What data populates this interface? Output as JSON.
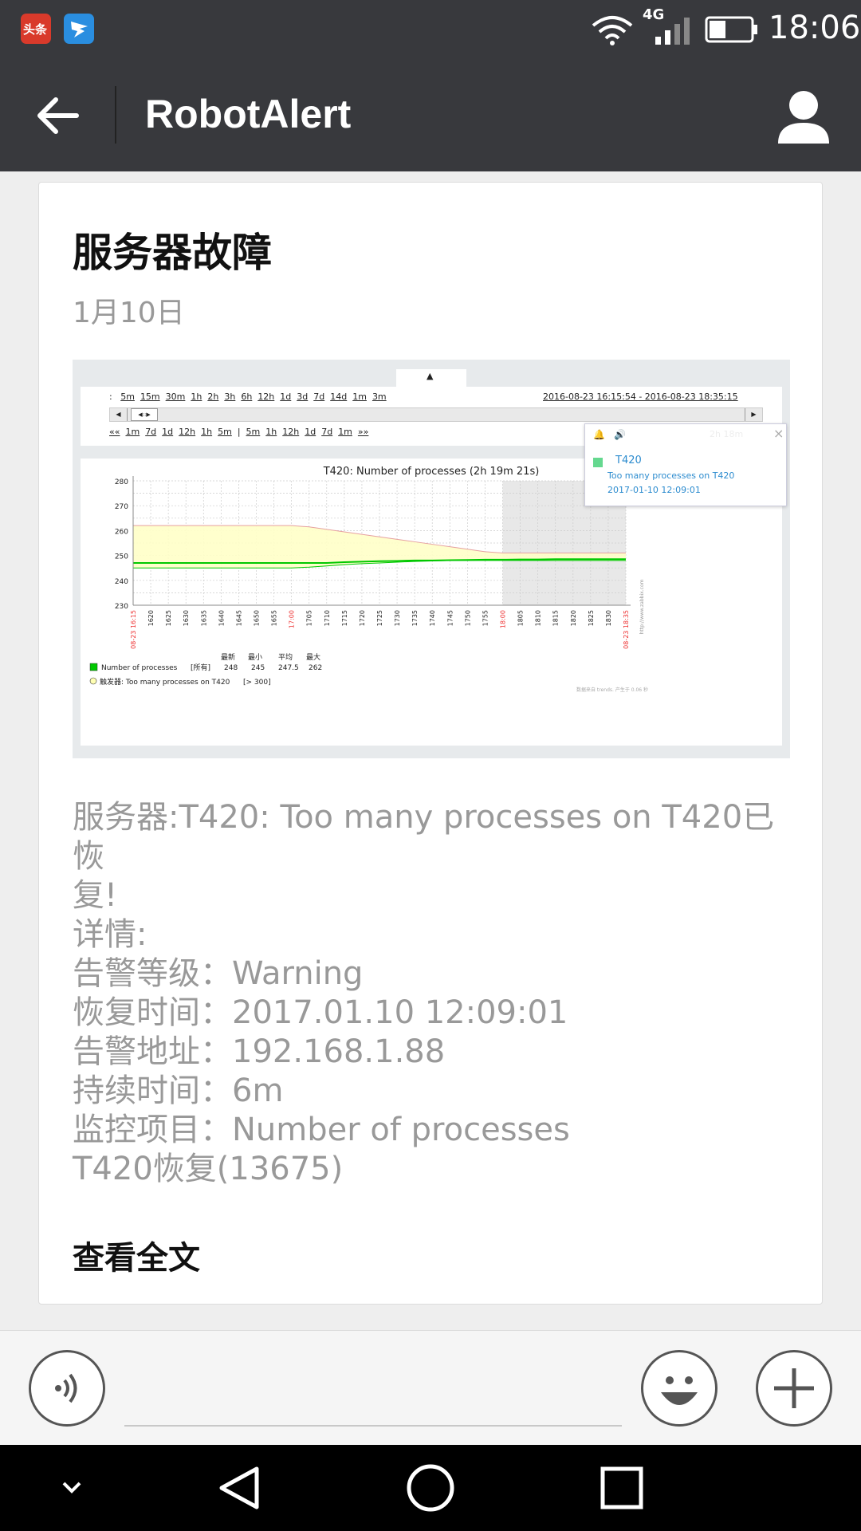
{
  "status_bar": {
    "time": "18:06",
    "network": "4G",
    "apps": [
      {
        "icon": "toutiao-app-icon",
        "label": "头条",
        "color": "#d93a2b"
      },
      {
        "icon": "dingtalk-app-icon",
        "color": "#2a8ee0"
      }
    ]
  },
  "app_bar": {
    "title": "RobotAlert",
    "back_icon": "back-arrow-icon",
    "profile_icon": "person-icon"
  },
  "message": {
    "title": "服务器故障",
    "date": "1月10日",
    "body_lines": [
      "服务器:T420: Too many processes on T420已恢",
      "复!",
      "详情:",
      "告警等级：Warning",
      "恢复时间：2017.01.10 12:09:01",
      "告警地址：192.168.1.88",
      "持续时间：6m",
      "监控项目：Number of processes",
      "T420恢复(13675)"
    ],
    "read_more": "查看全文"
  },
  "chart_image": {
    "zoom_label": ":",
    "zoom_options": [
      "5m",
      "15m",
      "30m",
      "1h",
      "2h",
      "3h",
      "6h",
      "12h",
      "1d",
      "3d",
      "7d",
      "14d",
      "1m",
      "3m"
    ],
    "date_range": "2016-08-23 16:15:54 - 2016-08-23 18:35:15",
    "nav_options": [
      "««",
      "1m",
      "7d",
      "1d",
      "12h",
      "1h",
      "5m",
      "|",
      "5m",
      "1h",
      "12h",
      "1d",
      "7d",
      "1m",
      "»»"
    ],
    "popup": {
      "host": "T420",
      "trigger": "Too many processes on T420",
      "time": "2017-01-10 12:09:01",
      "faded_text": "2h 18m"
    },
    "legend": {
      "headers": [
        "最新",
        "最小",
        "平均",
        "最大"
      ],
      "series_label": "Number of processes",
      "series_scope": "[所有]",
      "values": [
        "248",
        "245",
        "247.5",
        "262"
      ],
      "trigger_label": "触发器: Too many processes on T420",
      "trigger_threshold": "[> 300]",
      "footer": "数据来自 trends. 产生于 0.06 秒",
      "side_url": "http://www.zabbix.com"
    },
    "colors": {
      "line": "#00c800",
      "fill": "#ffffc8",
      "max_line": "#e6a0a0",
      "popup_text": "#2d8ccf",
      "red_tick": "#e33"
    }
  },
  "chart_data": {
    "type": "area",
    "title": "T420: Number of processes (2h 19m 21s)",
    "xlabel": "",
    "ylabel": "",
    "ylim": [
      230,
      280
    ],
    "yticks": [
      280,
      270,
      260,
      250,
      240,
      230
    ],
    "x": [
      "08-23 16:15",
      "1620",
      "1625",
      "1630",
      "1635",
      "1640",
      "1645",
      "1650",
      "1655",
      "17:00",
      "1705",
      "1710",
      "1715",
      "1720",
      "1725",
      "1730",
      "1735",
      "1740",
      "1745",
      "1750",
      "1755",
      "18:00",
      "1805",
      "1810",
      "1815",
      "1820",
      "1825",
      "1830",
      "08-23 18:35"
    ],
    "red_x_labels": [
      "08-23 16:15",
      "17:00",
      "18:00",
      "08-23 18:35"
    ],
    "series": [
      {
        "name": "最大",
        "values": [
          262,
          262,
          262,
          262,
          262,
          262,
          262,
          262,
          262,
          262,
          261.5,
          260.5,
          259.5,
          258.5,
          257.5,
          256.5,
          255.5,
          254.5,
          253.5,
          252.5,
          251.5,
          251,
          251,
          251,
          251,
          251,
          251,
          251,
          251
        ]
      },
      {
        "name": "平均",
        "values": [
          247,
          247,
          247,
          247,
          247,
          247,
          247,
          247,
          247,
          247,
          247,
          247,
          247.3,
          247.5,
          247.7,
          247.8,
          248,
          248,
          248.1,
          248.2,
          248.3,
          248.3,
          248.4,
          248.4,
          248.5,
          248.5,
          248.5,
          248.5,
          248.5
        ]
      },
      {
        "name": "最小",
        "values": [
          245,
          245,
          245,
          245,
          245,
          245,
          245,
          245,
          245,
          245,
          245.3,
          245.8,
          246.3,
          246.7,
          247,
          247.3,
          247.6,
          247.8,
          248,
          248,
          248,
          248,
          248,
          248,
          248,
          248,
          248,
          248,
          248
        ]
      }
    ],
    "grid": true,
    "legend_position": "bottom-left",
    "shaded_from": "18:00"
  }
}
